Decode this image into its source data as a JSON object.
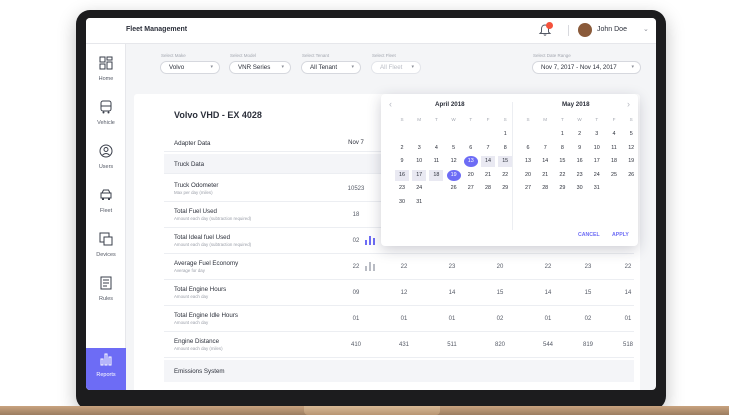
{
  "app": {
    "title": "Fleet Management"
  },
  "user": {
    "name": "John Doe"
  },
  "sidebar": {
    "items": [
      {
        "label": "Home",
        "icon": "dashboard-icon",
        "active": false
      },
      {
        "label": "Vehicle",
        "icon": "bus-icon",
        "active": false
      },
      {
        "label": "Users",
        "icon": "user-icon",
        "active": false
      },
      {
        "label": "Fleet",
        "icon": "truck-icon",
        "active": false
      },
      {
        "label": "Devices",
        "icon": "devices-icon",
        "active": false
      },
      {
        "label": "Rules",
        "icon": "rules-icon",
        "active": false
      },
      {
        "label": "Reports",
        "icon": "bar-chart-icon",
        "active": true
      }
    ]
  },
  "filters": {
    "make": {
      "label": "Select Make",
      "value": "Volvo"
    },
    "model": {
      "label": "Select Model",
      "value": "VNR Series"
    },
    "tenant": {
      "label": "Select Tenant",
      "value": "All Tenant"
    },
    "fleet": {
      "label": "Select Fleet",
      "value": "All Fleet"
    },
    "date_range": {
      "label": "Select Date Range",
      "value": "Nov 7, 2017 - Nov 14, 2017"
    }
  },
  "vehicle": {
    "title": "Volvo VHD - EX 4028"
  },
  "table": {
    "adapter_header": "Adapter Data",
    "first_col_header": "Nov 7",
    "truck_section": "Truck Data",
    "emissions_section": "Emissions System",
    "rows": [
      {
        "label": "Truck Odometer",
        "sub": "Max per day (miles)",
        "values": [
          "10523"
        ]
      },
      {
        "label": "Total Fuel Used",
        "sub": "Amount each day (subtraction required)",
        "values": [
          "18"
        ]
      },
      {
        "label": "Total Ideal fuel Used",
        "sub": "Amount each day (subtraction required)",
        "values": [
          "02"
        ]
      },
      {
        "label": "Average Fuel Economy",
        "sub": "Average for day",
        "values": [
          "22",
          "22",
          "23",
          "20",
          "22",
          "23",
          "22"
        ]
      },
      {
        "label": "Total Engine Hours",
        "sub": "Amount each day",
        "values": [
          "09",
          "12",
          "14",
          "15",
          "14",
          "15",
          "14"
        ]
      },
      {
        "label": "Total Engine Idle Hours",
        "sub": "Amount each day",
        "values": [
          "01",
          "01",
          "01",
          "02",
          "01",
          "02",
          "01"
        ]
      },
      {
        "label": "Engine Distance",
        "sub": "Amount each day (miles)",
        "values": [
          "410",
          "431",
          "511",
          "820",
          "544",
          "819",
          "518"
        ]
      }
    ]
  },
  "calendar": {
    "left_month": "April 2018",
    "right_month": "May 2018",
    "weekdays": [
      "S",
      "M",
      "T",
      "W",
      "T",
      "F",
      "S"
    ],
    "left_weeks": [
      [
        "",
        "",
        "",
        "",
        "",
        "",
        "1"
      ],
      [
        "2",
        "3",
        "4",
        "5",
        "6",
        "7",
        "8"
      ],
      [
        "9",
        "10",
        "11",
        "12",
        "13",
        "14",
        "15"
      ],
      [
        "16",
        "17",
        "18",
        "19",
        "20",
        "21",
        "22"
      ],
      [
        "23",
        "24",
        "",
        "26",
        "27",
        "28",
        "29"
      ],
      [
        "30",
        "31",
        "",
        "",
        "",
        "",
        ""
      ]
    ],
    "right_weeks": [
      [
        "",
        "",
        "1",
        "2",
        "3",
        "4",
        "5"
      ],
      [
        "6",
        "7",
        "8",
        "9",
        "10",
        "11",
        "12"
      ],
      [
        "13",
        "14",
        "15",
        "16",
        "17",
        "18",
        "19"
      ],
      [
        "20",
        "21",
        "22",
        "23",
        "24",
        "25",
        "26"
      ],
      [
        "27",
        "28",
        "29",
        "30",
        "31",
        "",
        ""
      ]
    ],
    "selected_start": "13",
    "selected_end": "19",
    "cancel_label": "CANCEL",
    "apply_label": "APPLY"
  },
  "colors": {
    "accent": "#6d6cf5",
    "badge": "#f4513b"
  }
}
